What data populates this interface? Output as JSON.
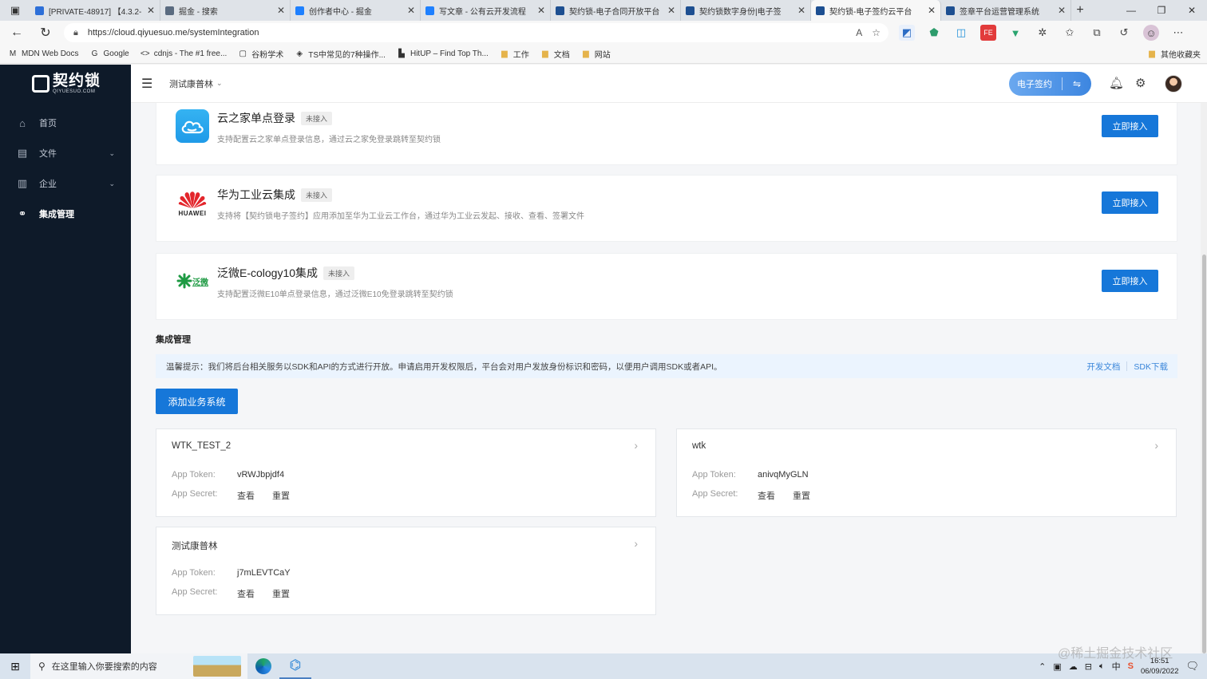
{
  "browser": {
    "tabs": [
      {
        "title": "[PRIVATE-48917] 【4.3.2-",
        "icon_color": "#2d6fd8",
        "active": false
      },
      {
        "title": "掘金 - 搜索",
        "icon_color": "#5a6b80",
        "active": false
      },
      {
        "title": "创作者中心 - 掘金",
        "icon_color": "#1e80ff",
        "active": false
      },
      {
        "title": "写文章 - 公有云开发流程",
        "icon_color": "#1e80ff",
        "active": false
      },
      {
        "title": "契约锁-电子合同开放平台",
        "icon_color": "#1d4f91",
        "active": false
      },
      {
        "title": "契约锁数字身份|电子签",
        "icon_color": "#1d4f91",
        "active": false
      },
      {
        "title": "契约锁-电子签约云平台",
        "icon_color": "#1d4f91",
        "active": true
      },
      {
        "title": "签章平台运营管理系统",
        "icon_color": "#1d4f91",
        "active": false
      }
    ],
    "url": "https://cloud.qiyuesuo.me/systemIntegration",
    "bookmarks": [
      {
        "label": "MDN Web Docs",
        "kind": "site",
        "icon": "M"
      },
      {
        "label": "Google",
        "kind": "site",
        "icon": "G"
      },
      {
        "label": "cdnjs - The #1 free...",
        "kind": "site",
        "icon": "<>"
      },
      {
        "label": "谷粉学术",
        "kind": "site",
        "icon": "▢"
      },
      {
        "label": "TS中常见的7种操作...",
        "kind": "site",
        "icon": "◈"
      },
      {
        "label": "HitUP – Find Top Th...",
        "kind": "site",
        "icon": "▙"
      },
      {
        "label": "工作",
        "kind": "folder",
        "icon": "▆"
      },
      {
        "label": "文档",
        "kind": "folder",
        "icon": "▆"
      },
      {
        "label": "网站",
        "kind": "folder",
        "icon": "▆"
      }
    ],
    "other_bookmarks": "其他收藏夹"
  },
  "sidebar": {
    "logo_text": "契约锁",
    "logo_sub": "QIYUESUO.COM",
    "items": [
      {
        "label": "首页",
        "icon": "home-icon",
        "glyph": "⌂",
        "has_arrow": false,
        "active": false
      },
      {
        "label": "文件",
        "icon": "file-icon",
        "glyph": "▤",
        "has_arrow": true,
        "active": false
      },
      {
        "label": "企业",
        "icon": "building-icon",
        "glyph": "▥",
        "has_arrow": true,
        "active": false
      },
      {
        "label": "集成管理",
        "icon": "integration-icon",
        "glyph": "⚭",
        "has_arrow": false,
        "active": true
      }
    ]
  },
  "topbar": {
    "tenant": "测试康普林",
    "sign_button": "电子签约",
    "sign_swap_glyph": "⇋"
  },
  "integrations": [
    {
      "name": "云之家单点登录",
      "status": "未接入",
      "desc": "支持配置云之家单点登录信息，通过云之家免登录跳转至契约锁",
      "button": "立即接入",
      "logo": "yunzhijia"
    },
    {
      "name": "华为工业云集成",
      "status": "未接入",
      "desc": "支持将【契约锁电子签约】应用添加至华为工业云工作台，通过华为工业云发起、接收、查看、签署文件",
      "button": "立即接入",
      "logo": "huawei",
      "logo_text": "HUAWEI"
    },
    {
      "name": "泛微E-cology10集成",
      "status": "未接入",
      "desc": "支持配置泛微E10单点登录信息，通过泛微E10免登录跳转至契约锁",
      "button": "立即接入",
      "logo": "fanwei",
      "logo_text": "泛微"
    }
  ],
  "management": {
    "title": "集成管理",
    "notice": "温馨提示：我们将后台相关服务以SDK和API的方式进行开放。申请启用开发权限后，平台会对用户发放身份标识和密码，以便用户调用SDK或者API。",
    "link_docs": "开发文档",
    "link_sdk": "SDK下载",
    "add_button": "添加业务系统",
    "token_label": "App Token:",
    "secret_label": "App Secret:",
    "view_label": "查看",
    "reset_label": "重置",
    "systems": [
      {
        "name": "WTK_TEST_2",
        "token": "vRWJbpjdf4"
      },
      {
        "name": "wtk",
        "token": "anivqMyGLN"
      },
      {
        "name": "测试康普林",
        "token": "j7mLEVTCaY"
      }
    ]
  },
  "watermark": "@稀土掘金技术社区",
  "taskbar": {
    "search_placeholder": "在这里输入你要搜索的内容",
    "time": "16:51",
    "date": "06/09/2022",
    "ime": "中"
  }
}
